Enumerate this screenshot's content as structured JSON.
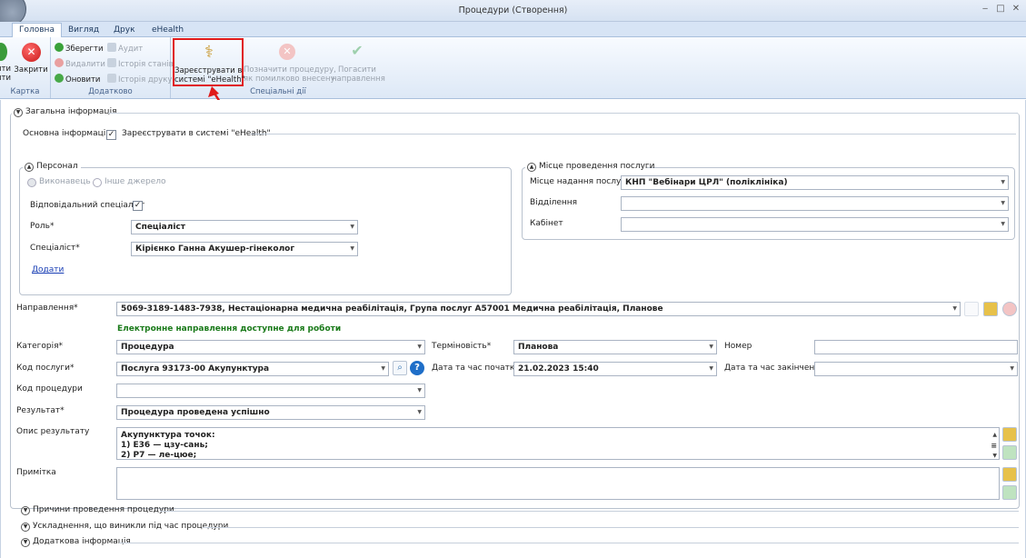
{
  "window": {
    "title": "Процедури (Створення)",
    "min": "‒",
    "max": "□",
    "close": "✕"
  },
  "tabs": [
    {
      "label": "Головна"
    },
    {
      "label": "Вигляд"
    },
    {
      "label": "Друк"
    },
    {
      "label": "eHealth"
    }
  ],
  "ribbon": {
    "left_btn1": "ити\nити",
    "left_btn2": "Закрити",
    "group_card": "Картка",
    "save": "Зберегти",
    "delete": "Видалити",
    "refresh": "Оновити",
    "audit": "Аудит",
    "history_states": "Історія станів",
    "history_print": "Історія друку",
    "group_additional": "Додатково",
    "register": "Зареєструвати в\nсистемі \"eHealth\"",
    "mark_wrong": "Позначити процедуру,\nяк помилково внесену",
    "cancel_referral": "Погасити\nнаправлення",
    "group_special": "Спеціальні дії"
  },
  "sections": {
    "general": "Загальна інформація",
    "main_info": "Основна інформація",
    "register_check": "Зареєструвати в системі \"eHealth\"",
    "reasons": "Причини проведення процедури",
    "complications": "Ускладнення, що виникли під час процедури",
    "additional": "Додаткова інформація"
  },
  "personnel": {
    "title": "Персонал",
    "radio1": "Виконавець",
    "radio2": "Інше джерело",
    "responsible": "Відповідальний спеціаліст",
    "role_label": "Роль*",
    "role_value": "Спеціаліст",
    "spec_label": "Спеціаліст*",
    "spec_value": "Кірієнко Ганна Акушер-гінеколог",
    "add": "Додати"
  },
  "place": {
    "title": "Місце проведення послуги",
    "provider_label": "Місце надання послуг*",
    "provider_value": "КНП \"Вебінари ЦРЛ\" (поліклініка)",
    "dept_label": "Відділення",
    "dept_value": "",
    "room_label": "Кабінет",
    "room_value": ""
  },
  "form": {
    "referral_label": "Направлення*",
    "referral_value": "5069-3189-1483-7938, Нестаціонарна медична реабілітація, Група послуг А57001 Медична реабілітація, Планове",
    "referral_status": "Електронне направлення доступне для роботи",
    "category_label": "Категорія*",
    "category_value": "Процедура",
    "urgency_label": "Терміновість*",
    "urgency_value": "Планова",
    "number_label": "Номер",
    "number_value": "",
    "service_label": "Код послуги*",
    "service_value": "Послуга 93173-00 Акупунктура",
    "start_label": "Дата та час початку*",
    "start_value": "21.02.2023 15:40",
    "end_label": "Дата та час закінчення",
    "end_value": "",
    "proc_code_label": "Код процедури",
    "proc_code_value": "",
    "result_label": "Результат*",
    "result_value": "Процедура проведена успішно",
    "desc_label": "Опис результату",
    "desc_lines": [
      "Акупунктура точок:",
      "1) E36 — цзу-сань;",
      "2) P7 — ле-цюе;"
    ],
    "note_label": "Примітка",
    "note_value": ""
  },
  "colors": {
    "accent": "#e01a1a",
    "ribbon_bg": "#dde8f6",
    "link": "#1a3fb5",
    "success": "#1a7a1a"
  }
}
